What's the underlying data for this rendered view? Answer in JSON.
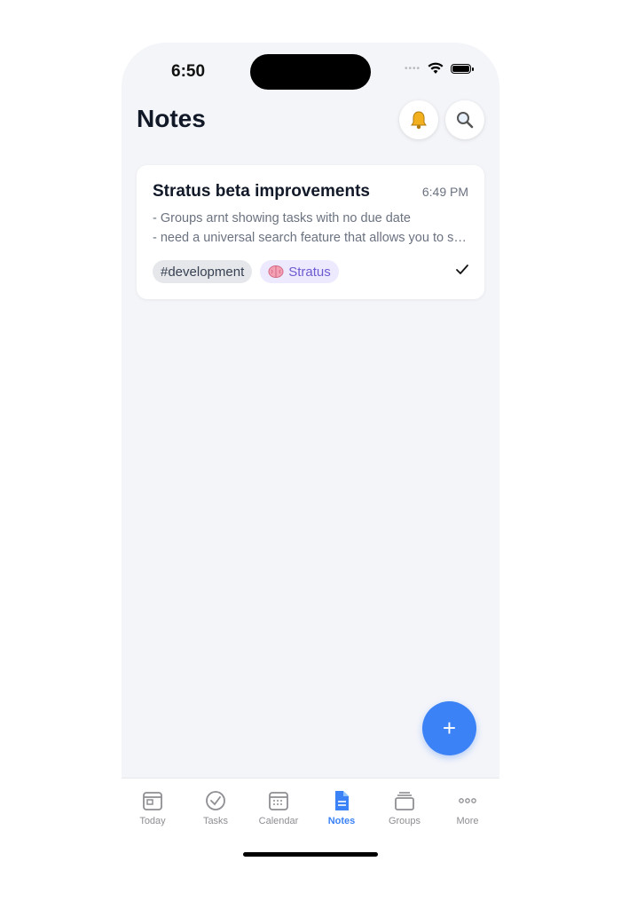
{
  "status_bar": {
    "time": "6:50",
    "dots": "••••"
  },
  "header": {
    "title": "Notes"
  },
  "notes": [
    {
      "title": "Stratus beta improvements",
      "time": "6:49 PM",
      "lines": [
        "- Groups arnt showing tasks with no due date",
        "- need a universal search feature that allows you to search across all tasks, notes, and groups"
      ],
      "tags": [
        "#development",
        "Stratus"
      ],
      "completed": true
    }
  ],
  "fab": {
    "label": "+"
  },
  "tabs": [
    {
      "label": "Today",
      "icon": "today-icon"
    },
    {
      "label": "Tasks",
      "icon": "check-circle-icon"
    },
    {
      "label": "Calendar",
      "icon": "calendar-icon"
    },
    {
      "label": "Notes",
      "icon": "document-icon",
      "active": true
    },
    {
      "label": "Groups",
      "icon": "stack-icon"
    },
    {
      "label": "More",
      "icon": "more-icon"
    }
  ],
  "colors": {
    "accent": "#3b82f6",
    "background": "#f4f5f9",
    "tag_purple": "#6d5bd0"
  }
}
